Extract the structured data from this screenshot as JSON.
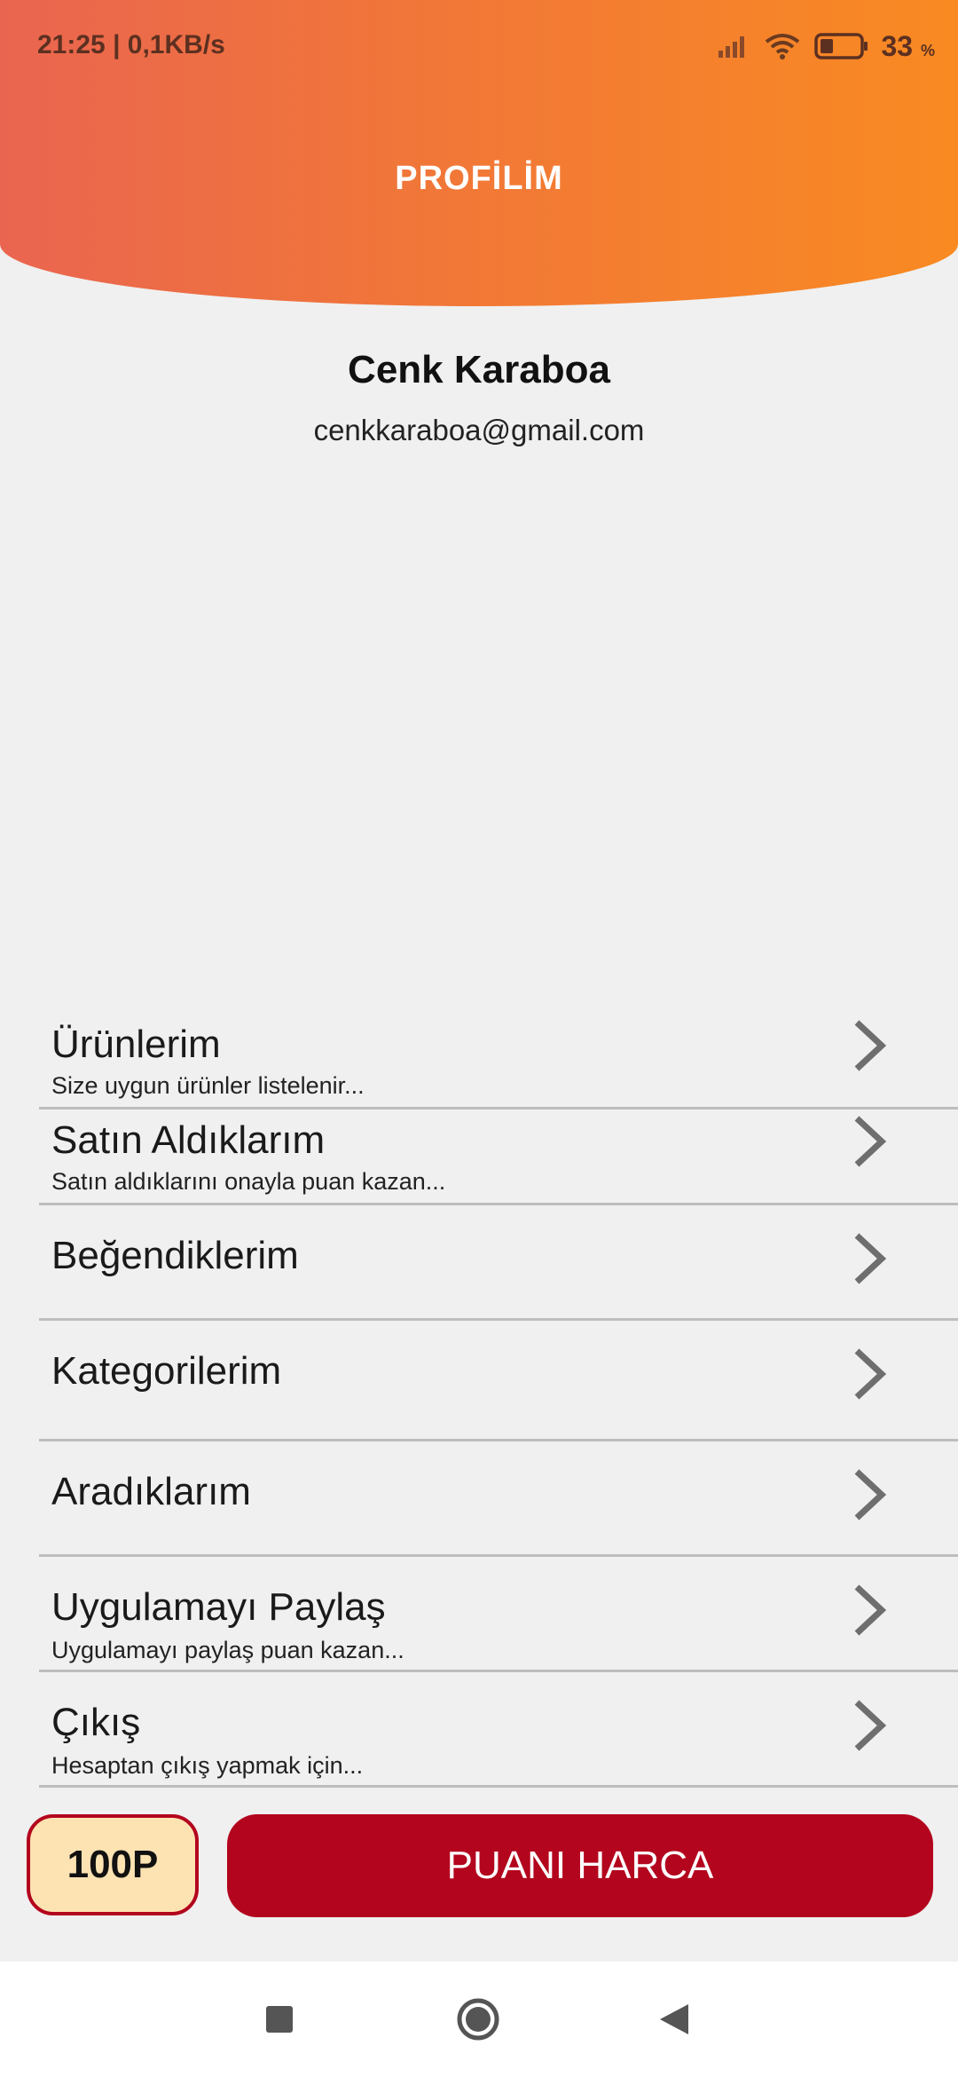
{
  "status_bar": {
    "time": "21:25 | 0,1KB/s",
    "battery": "33",
    "battery_unit": "%"
  },
  "header": {
    "title": "PROFİLİM",
    "gradient_start": "#ea6550",
    "gradient_end": "#f98a22"
  },
  "profile": {
    "name": "Cenk Karaboa",
    "email": "cenkkaraboa@gmail.com"
  },
  "menu": {
    "items": [
      {
        "title": "Ürünlerim",
        "subtitle": "Size uygun ürünler listelenir..."
      },
      {
        "title": "Satın Aldıklarım",
        "subtitle": "Satın aldıklarını onayla puan kazan..."
      },
      {
        "title": "Beğendiklerim",
        "subtitle": ""
      },
      {
        "title": "Kategorilerim",
        "subtitle": ""
      },
      {
        "title": "Aradıklarım",
        "subtitle": ""
      },
      {
        "title": "Uygulamayı Paylaş",
        "subtitle": "Uygulamayı paylaş puan kazan..."
      },
      {
        "title": "Çıkış",
        "subtitle": "Hesaptan çıkış yapmak için..."
      }
    ]
  },
  "actions": {
    "points": "100P",
    "spend_label": "PUANI HARCA",
    "accent_color": "#b3051d"
  },
  "nav": {
    "icons": [
      "recents-square-icon",
      "home-circle-icon",
      "back-triangle-icon"
    ]
  }
}
